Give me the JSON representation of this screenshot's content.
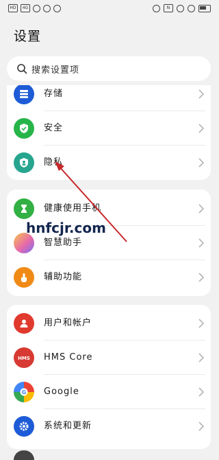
{
  "status_bar": {
    "left": [
      "HD",
      "4G",
      "📶"
    ],
    "right": [
      "👁",
      "N",
      "🔕",
      "✱"
    ]
  },
  "page": {
    "title": "设置"
  },
  "search": {
    "placeholder": "搜索设置项"
  },
  "groups": [
    {
      "items": [
        {
          "label": "存储",
          "icon": "storage-icon",
          "color": "#1e5bd6"
        },
        {
          "label": "安全",
          "icon": "shield-check-icon",
          "color": "#27b54a"
        },
        {
          "label": "隐私",
          "icon": "privacy-shield-icon",
          "color": "#27a58f"
        }
      ]
    },
    {
      "items": [
        {
          "label": "健康使用手机",
          "icon": "hourglass-icon",
          "color": "#33b044"
        },
        {
          "label": "智慧助手",
          "icon": "assistant-orb-icon",
          "color": "#e86aa8"
        },
        {
          "label": "辅助功能",
          "icon": "hand-icon",
          "color": "#f08a16"
        }
      ]
    },
    {
      "items": [
        {
          "label": "用户和帐户",
          "icon": "user-icon",
          "color": "#e0392e"
        },
        {
          "label": "HMS Core",
          "icon": "hms-icon",
          "color": "#d73a33"
        },
        {
          "label": "Google",
          "icon": "google-icon",
          "color": "#4285f4"
        },
        {
          "label": "系统和更新",
          "icon": "gear-icon",
          "color": "#1e5bd6"
        }
      ]
    }
  ],
  "watermark": "hnfcjr.com"
}
